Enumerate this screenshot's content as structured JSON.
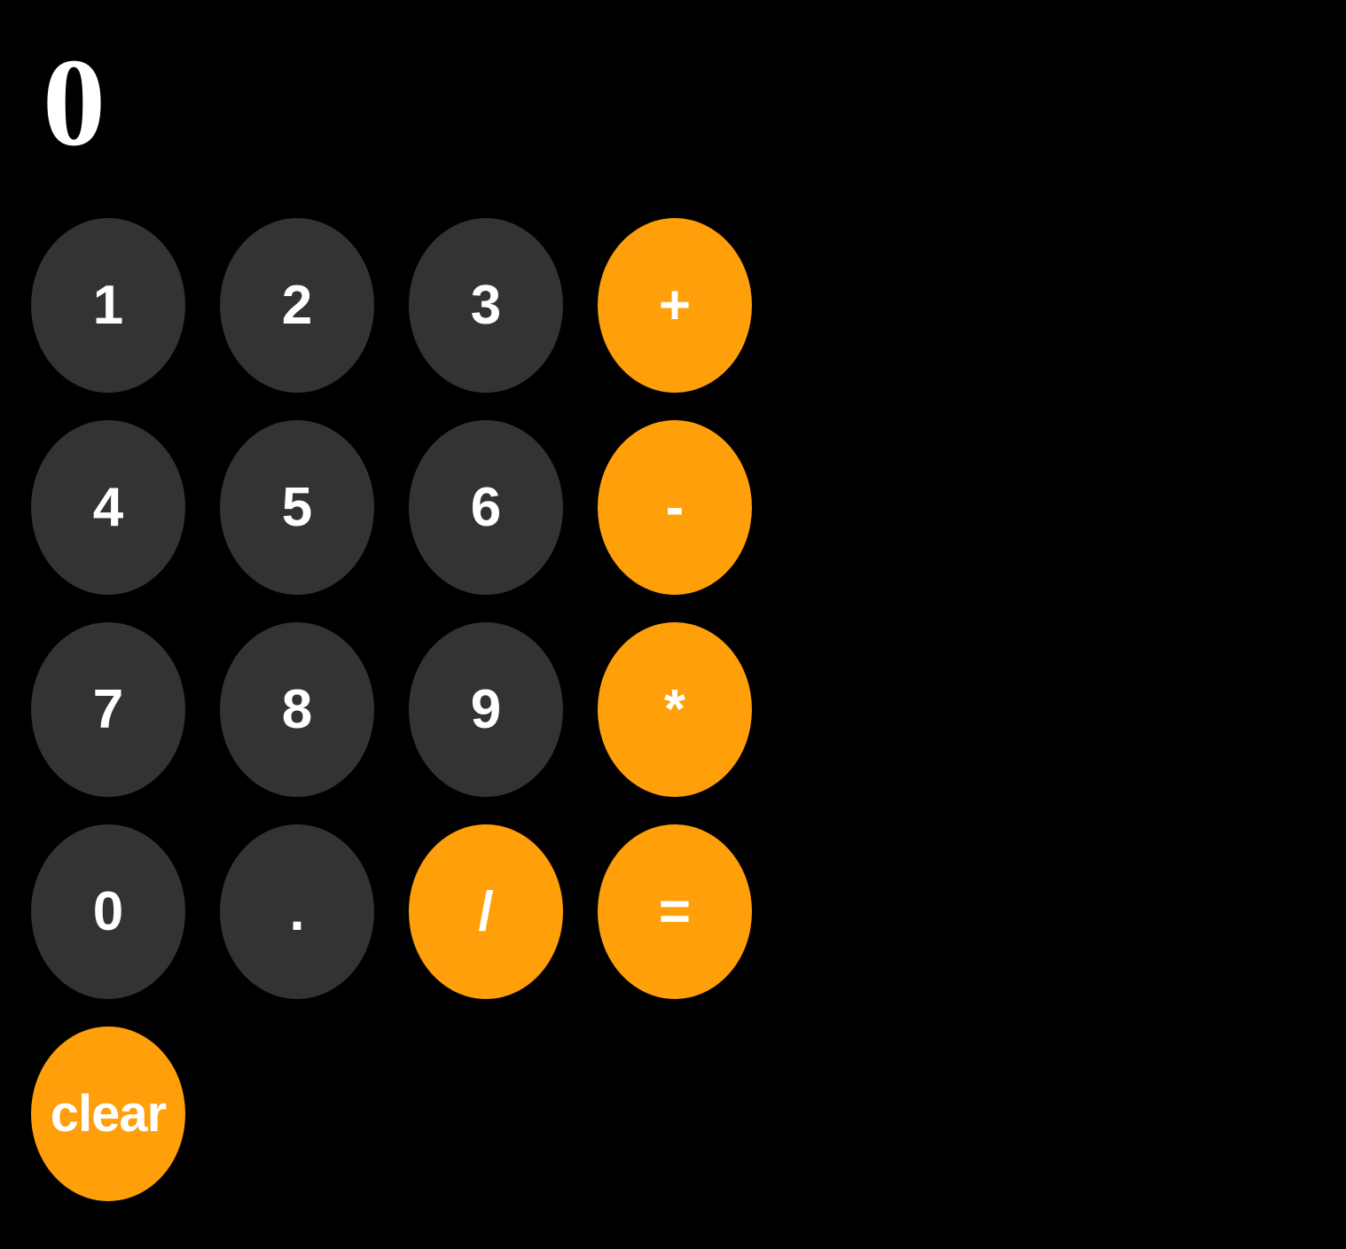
{
  "display": {
    "value": "0"
  },
  "keys": {
    "k1": "1",
    "k2": "2",
    "k3": "3",
    "plus": "+",
    "k4": "4",
    "k5": "5",
    "k6": "6",
    "minus": "-",
    "k7": "7",
    "k8": "8",
    "k9": "9",
    "multiply": "*",
    "k0": "0",
    "dot": ".",
    "divide": "/",
    "equals": "=",
    "clear": "clear"
  },
  "colors": {
    "background": "#000000",
    "digit_key": "#333333",
    "operator_key": "#ff9f0a",
    "text": "#ffffff"
  }
}
